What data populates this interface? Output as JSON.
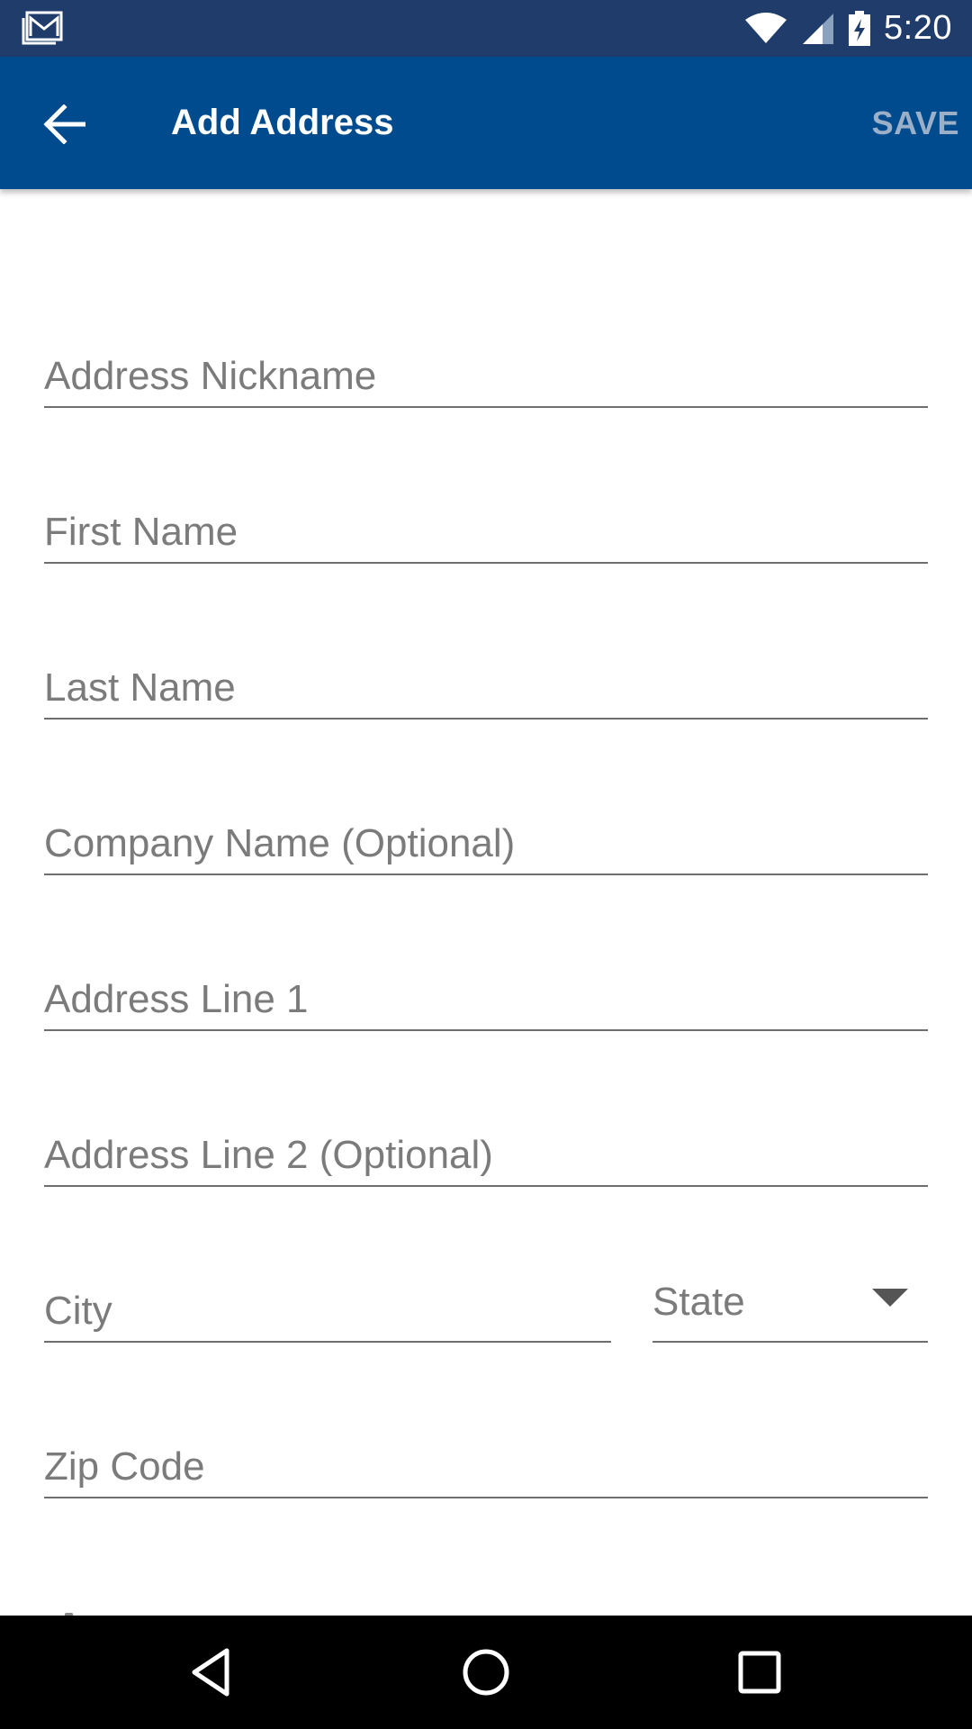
{
  "status_bar": {
    "time": "5:20",
    "icons": [
      "gmail-notification-icon",
      "wifi-icon",
      "cellular-signal-icon",
      "battery-charging-icon"
    ]
  },
  "app_bar": {
    "title": "Add Address",
    "save_label": "SAVE",
    "back_icon": "arrow-back-icon",
    "colors": {
      "status_bar_bg": "#1f3c6b",
      "app_bar_bg": "#004b8d",
      "save_disabled": "#9bb0c8"
    }
  },
  "form": {
    "address_nickname": {
      "placeholder": "Address Nickname",
      "value": ""
    },
    "first_name": {
      "placeholder": "First Name",
      "value": ""
    },
    "last_name": {
      "placeholder": "Last Name",
      "value": ""
    },
    "company_name": {
      "placeholder": "Company Name (Optional)",
      "value": ""
    },
    "address_line1": {
      "placeholder": "Address Line 1",
      "value": ""
    },
    "address_line2": {
      "placeholder": "Address Line 2 (Optional)",
      "value": ""
    },
    "city": {
      "placeholder": "City",
      "value": ""
    },
    "state": {
      "label": "State"
    },
    "zip_code": {
      "placeholder": "Zip Code",
      "value": ""
    },
    "phone_number": {
      "placeholder": "Phone Number",
      "value": "",
      "icon": "phone-icon"
    }
  },
  "nav_bar": {
    "buttons": [
      "back-triangle-icon",
      "home-circle-icon",
      "recents-square-icon"
    ]
  }
}
